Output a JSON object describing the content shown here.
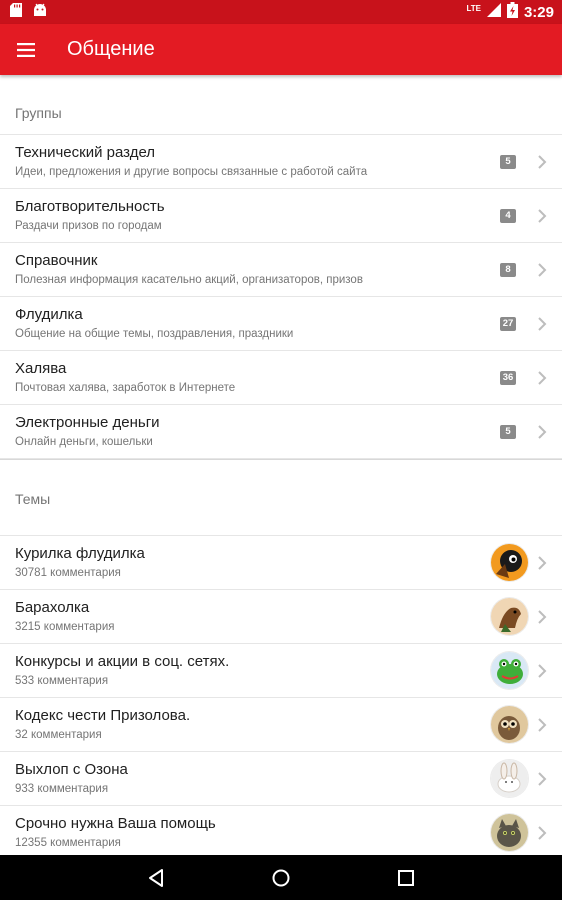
{
  "status_bar": {
    "time": "3:29",
    "network": "LTE",
    "icons": [
      "sd-card-icon",
      "android-icon",
      "signal-icon",
      "battery-charging-icon"
    ]
  },
  "app_bar": {
    "title": "Общение",
    "menu_icon": "hamburger-menu-icon"
  },
  "groups": {
    "header": "Группы",
    "items": [
      {
        "title": "Технический раздел",
        "subtitle": "Идеи, предложения и другие вопросы связанные с работой сайта",
        "badge": "5"
      },
      {
        "title": "Благотворительность",
        "subtitle": "Раздачи призов по городам",
        "badge": "4"
      },
      {
        "title": "Справочник",
        "subtitle": "Полезная информация касательно акций, организаторов, призов",
        "badge": "8"
      },
      {
        "title": "Флудилка",
        "subtitle": "Общение на общие темы, поздравления, праздники",
        "badge": "27"
      },
      {
        "title": "Халява",
        "subtitle": "Почтовая халява, заработок в Интернете",
        "badge": "36"
      },
      {
        "title": "Электронные деньги",
        "subtitle": "Онлайн деньги, кошельки",
        "badge": "5"
      }
    ]
  },
  "topics": {
    "header": "Темы",
    "items": [
      {
        "title": "Курилка флудилка",
        "subtitle": "30781 комментария",
        "avatar": "avatar-orange-dark",
        "avatar_colors": [
          "#f29a1f",
          "#1a1a1a"
        ]
      },
      {
        "title": "Барахолка",
        "subtitle": "3215 комментария",
        "avatar": "avatar-horse",
        "avatar_colors": [
          "#f0d6b4",
          "#7a4a22"
        ]
      },
      {
        "title": "Конкурсы и акции в соц. сетях.",
        "subtitle": "533 комментария",
        "avatar": "avatar-green-frog",
        "avatar_colors": [
          "#d9e8f5",
          "#3fae3a"
        ]
      },
      {
        "title": "Кодекс чести Призолова.",
        "subtitle": "32 комментария",
        "avatar": "avatar-owl",
        "avatar_colors": [
          "#e0c89e",
          "#7a5a3a"
        ]
      },
      {
        "title": "Выхлоп с Озона",
        "subtitle": "933 комментария",
        "avatar": "avatar-white-rabbit",
        "avatar_colors": [
          "#eeeeee",
          "#c9b7a5"
        ]
      },
      {
        "title": "Срочно нужна Ваша помощь",
        "subtitle": "12355 комментария",
        "avatar": "avatar-cat",
        "avatar_colors": [
          "#cfc39a",
          "#5a5548"
        ]
      }
    ]
  },
  "nav_bar": {
    "buttons": [
      "back-icon",
      "home-icon",
      "recents-icon"
    ]
  },
  "colors": {
    "status_bar": "#c8121b",
    "app_bar": "#e31b23",
    "badge": "#8a8a8a",
    "divider": "#e6e6e6"
  }
}
